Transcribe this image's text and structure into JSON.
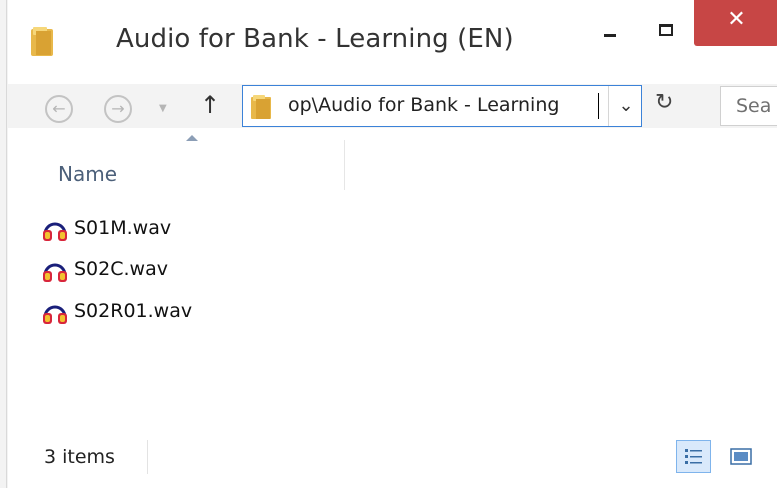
{
  "window": {
    "title": "Audio for Bank - Learning (EN)",
    "close_glyph": "✕"
  },
  "nav": {
    "back_glyph": "←",
    "forward_glyph": "→",
    "recent_glyph": "▼",
    "up_glyph": "↑"
  },
  "address": {
    "path_text": "op\\Audio for Bank - Learning",
    "dropdown_glyph": "⌄"
  },
  "refresh_glyph": "↻",
  "search": {
    "placeholder": "Sea"
  },
  "columns": {
    "name_label": "Name"
  },
  "files": [
    {
      "name": "S01M.wav",
      "icon": "headphones-icon"
    },
    {
      "name": "S02C.wav",
      "icon": "headphones-icon"
    },
    {
      "name": "S02R01.wav",
      "icon": "headphones-icon"
    }
  ],
  "status": {
    "item_count": "3 items"
  },
  "colors": {
    "accent": "#3b82d8",
    "close_button": "#c74645",
    "folder": "#e8b84a",
    "headphone_red": "#d8263b",
    "headphone_yellow": "#f2c230",
    "headphone_band": "#1a1f7a"
  }
}
